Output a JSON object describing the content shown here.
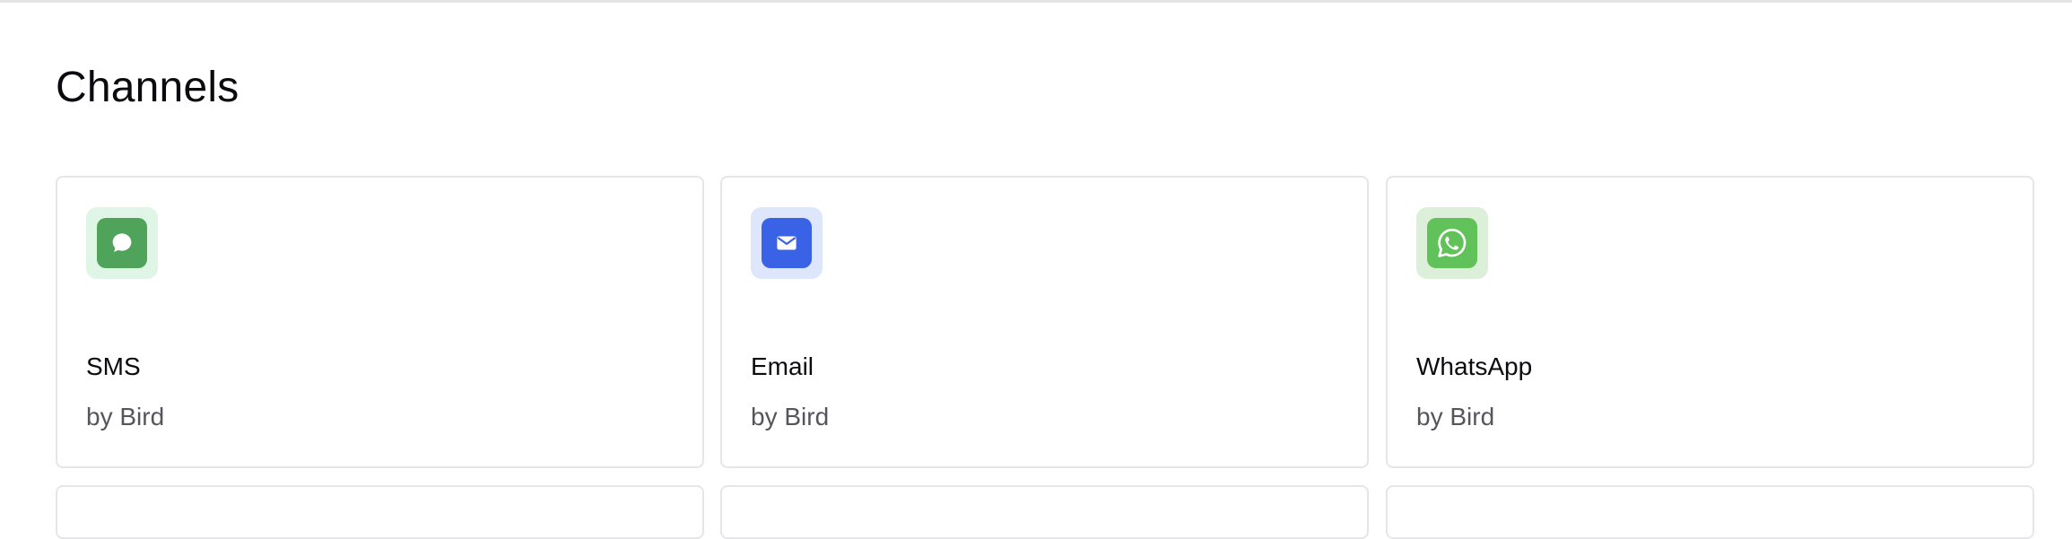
{
  "section": {
    "title": "Channels"
  },
  "channels": [
    {
      "name": "SMS",
      "vendor": "by Bird",
      "icon": "sms-chat-bubble-icon",
      "icon_bg": "#dff5e6",
      "icon_fg": "#4fa35a"
    },
    {
      "name": "Email",
      "vendor": "by Bird",
      "icon": "email-envelope-icon",
      "icon_bg": "#dde6fb",
      "icon_fg": "#3a62e6"
    },
    {
      "name": "WhatsApp",
      "vendor": "by Bird",
      "icon": "whatsapp-icon",
      "icon_bg": "#dcefd9",
      "icon_fg": "#62c25a"
    }
  ]
}
